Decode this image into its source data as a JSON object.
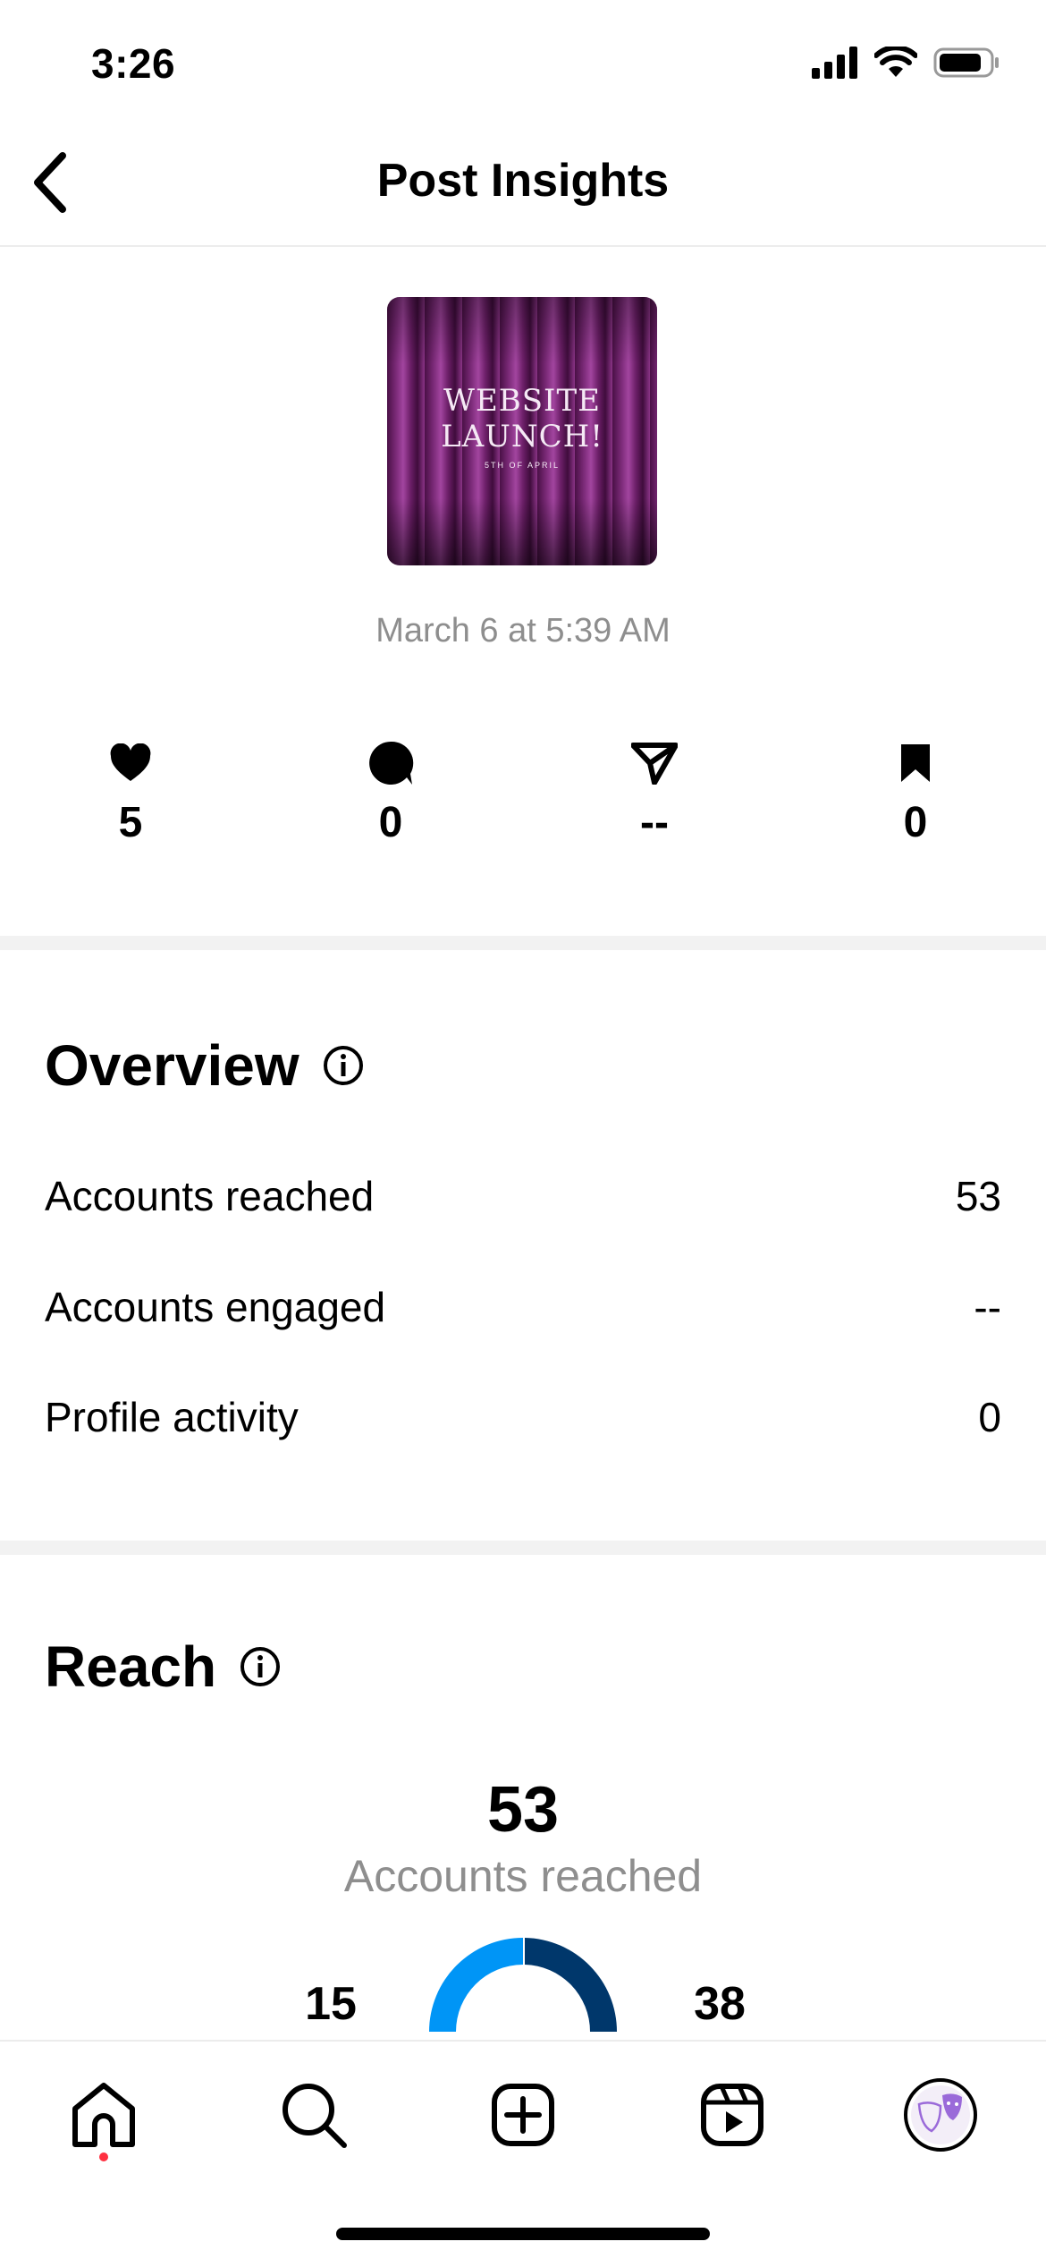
{
  "status_bar": {
    "time": "3:26"
  },
  "header": {
    "title": "Post Insights"
  },
  "post": {
    "thumbnail_title": "WEBSITE LAUNCH!",
    "thumbnail_subtitle": "5TH OF APRIL",
    "date": "March 6 at 5:39 AM"
  },
  "stats": [
    {
      "icon": "heart-icon",
      "value": "5"
    },
    {
      "icon": "comment-icon",
      "value": "0"
    },
    {
      "icon": "share-icon",
      "value": "--"
    },
    {
      "icon": "bookmark-icon",
      "value": "0"
    }
  ],
  "overview": {
    "title": "Overview",
    "rows": [
      {
        "label": "Accounts reached",
        "value": "53"
      },
      {
        "label": "Accounts engaged",
        "value": "--"
      },
      {
        "label": "Profile activity",
        "value": "0"
      }
    ]
  },
  "reach": {
    "title": "Reach",
    "total": "53",
    "total_label": "Accounts reached",
    "left_value": "15",
    "right_value": "38"
  },
  "bottom_nav": [
    "home-icon",
    "search-icon",
    "create-icon",
    "reels-icon",
    "profile-avatar"
  ],
  "colors": {
    "donut_light": "#0095f6",
    "donut_dark": "#00376b",
    "notification_dot": "#ff3040"
  }
}
